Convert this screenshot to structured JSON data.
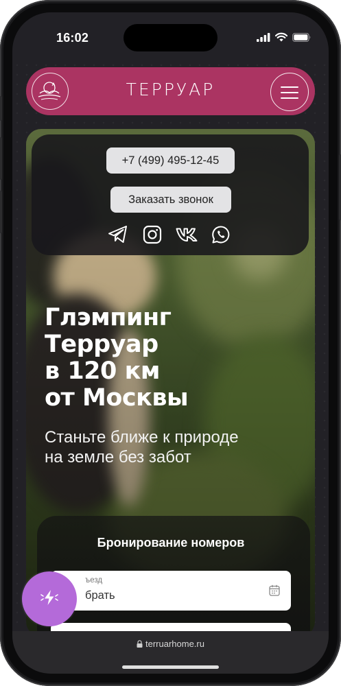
{
  "status_bar": {
    "time": "16:02"
  },
  "header": {
    "brand": "ТЕРРУАР",
    "logo_icon": "sun-hills-logo",
    "menu_icon": "hamburger-menu-icon",
    "accent_color": "#ab3462"
  },
  "contacts": {
    "phone": "+7 (499) 495-12-45",
    "callback_label": "Заказать звонок",
    "socials": [
      "telegram-icon",
      "instagram-icon",
      "vk-icon",
      "whatsapp-icon"
    ]
  },
  "hero": {
    "title_lines": [
      "Глэмпинг",
      "Терруар",
      "в 120 км",
      "от Москвы"
    ],
    "subtitle_lines": [
      "Станьте ближе к природе",
      "на земле без забот"
    ]
  },
  "booking": {
    "title": "Бронирование номеров",
    "checkin_label": "ъезд",
    "checkin_value": "брать",
    "calendar_icon": "calendar-icon"
  },
  "fab": {
    "icon": "lightning-icon",
    "color": "#b46ad9"
  },
  "browser": {
    "url": "terruarhome.ru",
    "lock_icon": "lock-icon"
  }
}
